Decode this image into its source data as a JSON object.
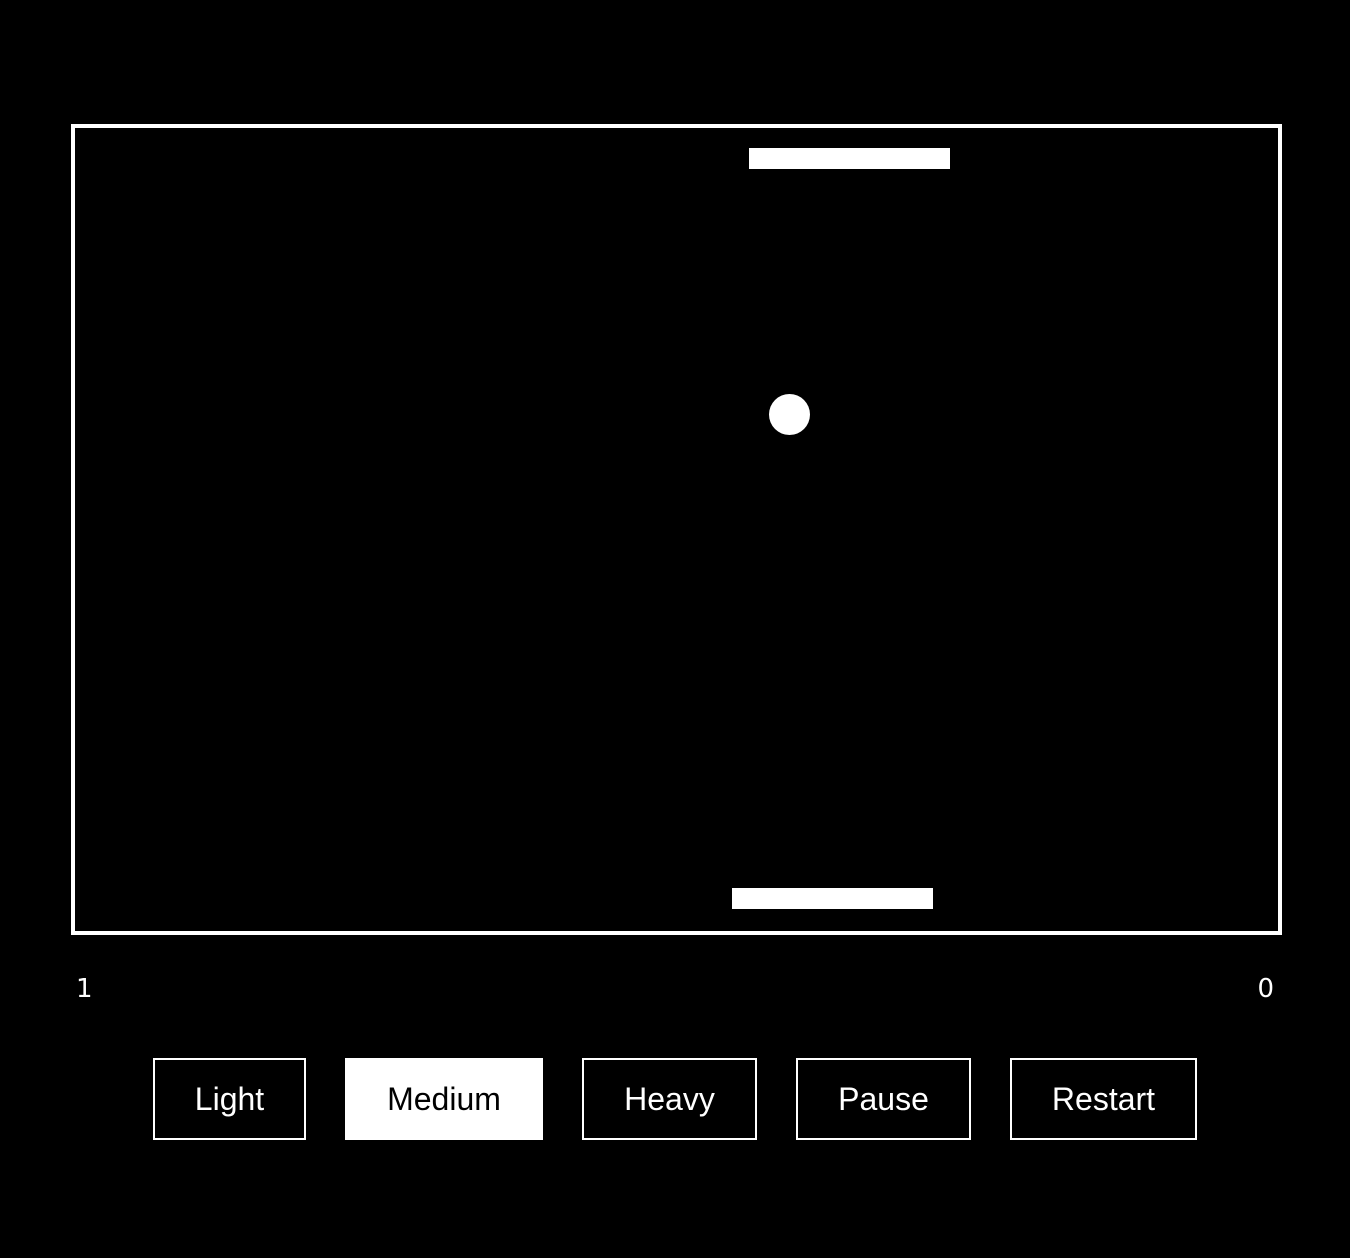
{
  "scores": {
    "left": "1",
    "right": "0"
  },
  "controls": {
    "light_label": "Light",
    "medium_label": "Medium",
    "heavy_label": "Heavy",
    "pause_label": "Pause",
    "restart_label": "Restart",
    "selected": "Medium"
  },
  "colors": {
    "background": "#000000",
    "foreground": "#ffffff"
  }
}
